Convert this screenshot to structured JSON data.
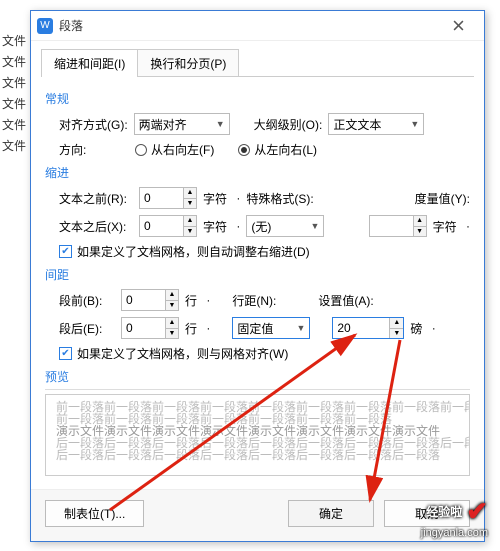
{
  "bg_items": [
    "文件",
    "文件",
    "文件",
    "文件",
    "文件",
    "文件"
  ],
  "dialog": {
    "title": "段落",
    "icon_letter": "W",
    "tabs": {
      "indent": "缩进和间距(I)",
      "pagination": "换行和分页(P)"
    },
    "sections": {
      "general": "常规",
      "indent": "缩进",
      "spacing": "间距",
      "preview": "预览"
    },
    "general": {
      "align_label": "对齐方式(G):",
      "align_value": "两端对齐",
      "outline_label": "大纲级别(O):",
      "outline_value": "正文文本",
      "direction_label": "方向:",
      "rtl": "从右向左(F)",
      "ltr": "从左向右(L)"
    },
    "indent": {
      "before_label": "文本之前(R):",
      "before_value": "0",
      "after_label": "文本之后(X):",
      "after_value": "0",
      "unit_char": "字符",
      "special_label": "特殊格式(S):",
      "special_value": "(无)",
      "metric_label": "度量值(Y):",
      "metric_value": "",
      "checkbox": "如果定义了文档网格，则自动调整右缩进(D)"
    },
    "spacing": {
      "before_label": "段前(B):",
      "before_value": "0",
      "after_label": "段后(E):",
      "after_value": "0",
      "unit_line": "行",
      "line_spacing_label": "行距(N):",
      "line_spacing_value": "固定值",
      "set_value_label": "设置值(A):",
      "set_value": "20",
      "unit_pt": "磅",
      "checkbox": "如果定义了文档网格，则与网格对齐(W)"
    },
    "preview_text": {
      "p1": "前一段落前一段落前一段落前一段落前一段落前一段落前一段落前一段落前一段落前一段落",
      "p2": "前一段落前一段落前一段落前一段落前一段落前一段落前一段落",
      "p3": "演示文件演示文件演示文件演示文件演示文件演示文件演示文件演示文件",
      "p4": "后一段落后一段落后一段落后一段落后一段落后一段落后一段落后一段落后一段落",
      "p5": "后一段落后一段落后一段落后一段落后一段落后一段落后一段落后一段落"
    },
    "footer": {
      "tabs_btn": "制表位(T)...",
      "ok": "确定",
      "cancel": "取消"
    }
  },
  "watermark": {
    "text": "经验啦",
    "url": "jingyanla.com"
  }
}
